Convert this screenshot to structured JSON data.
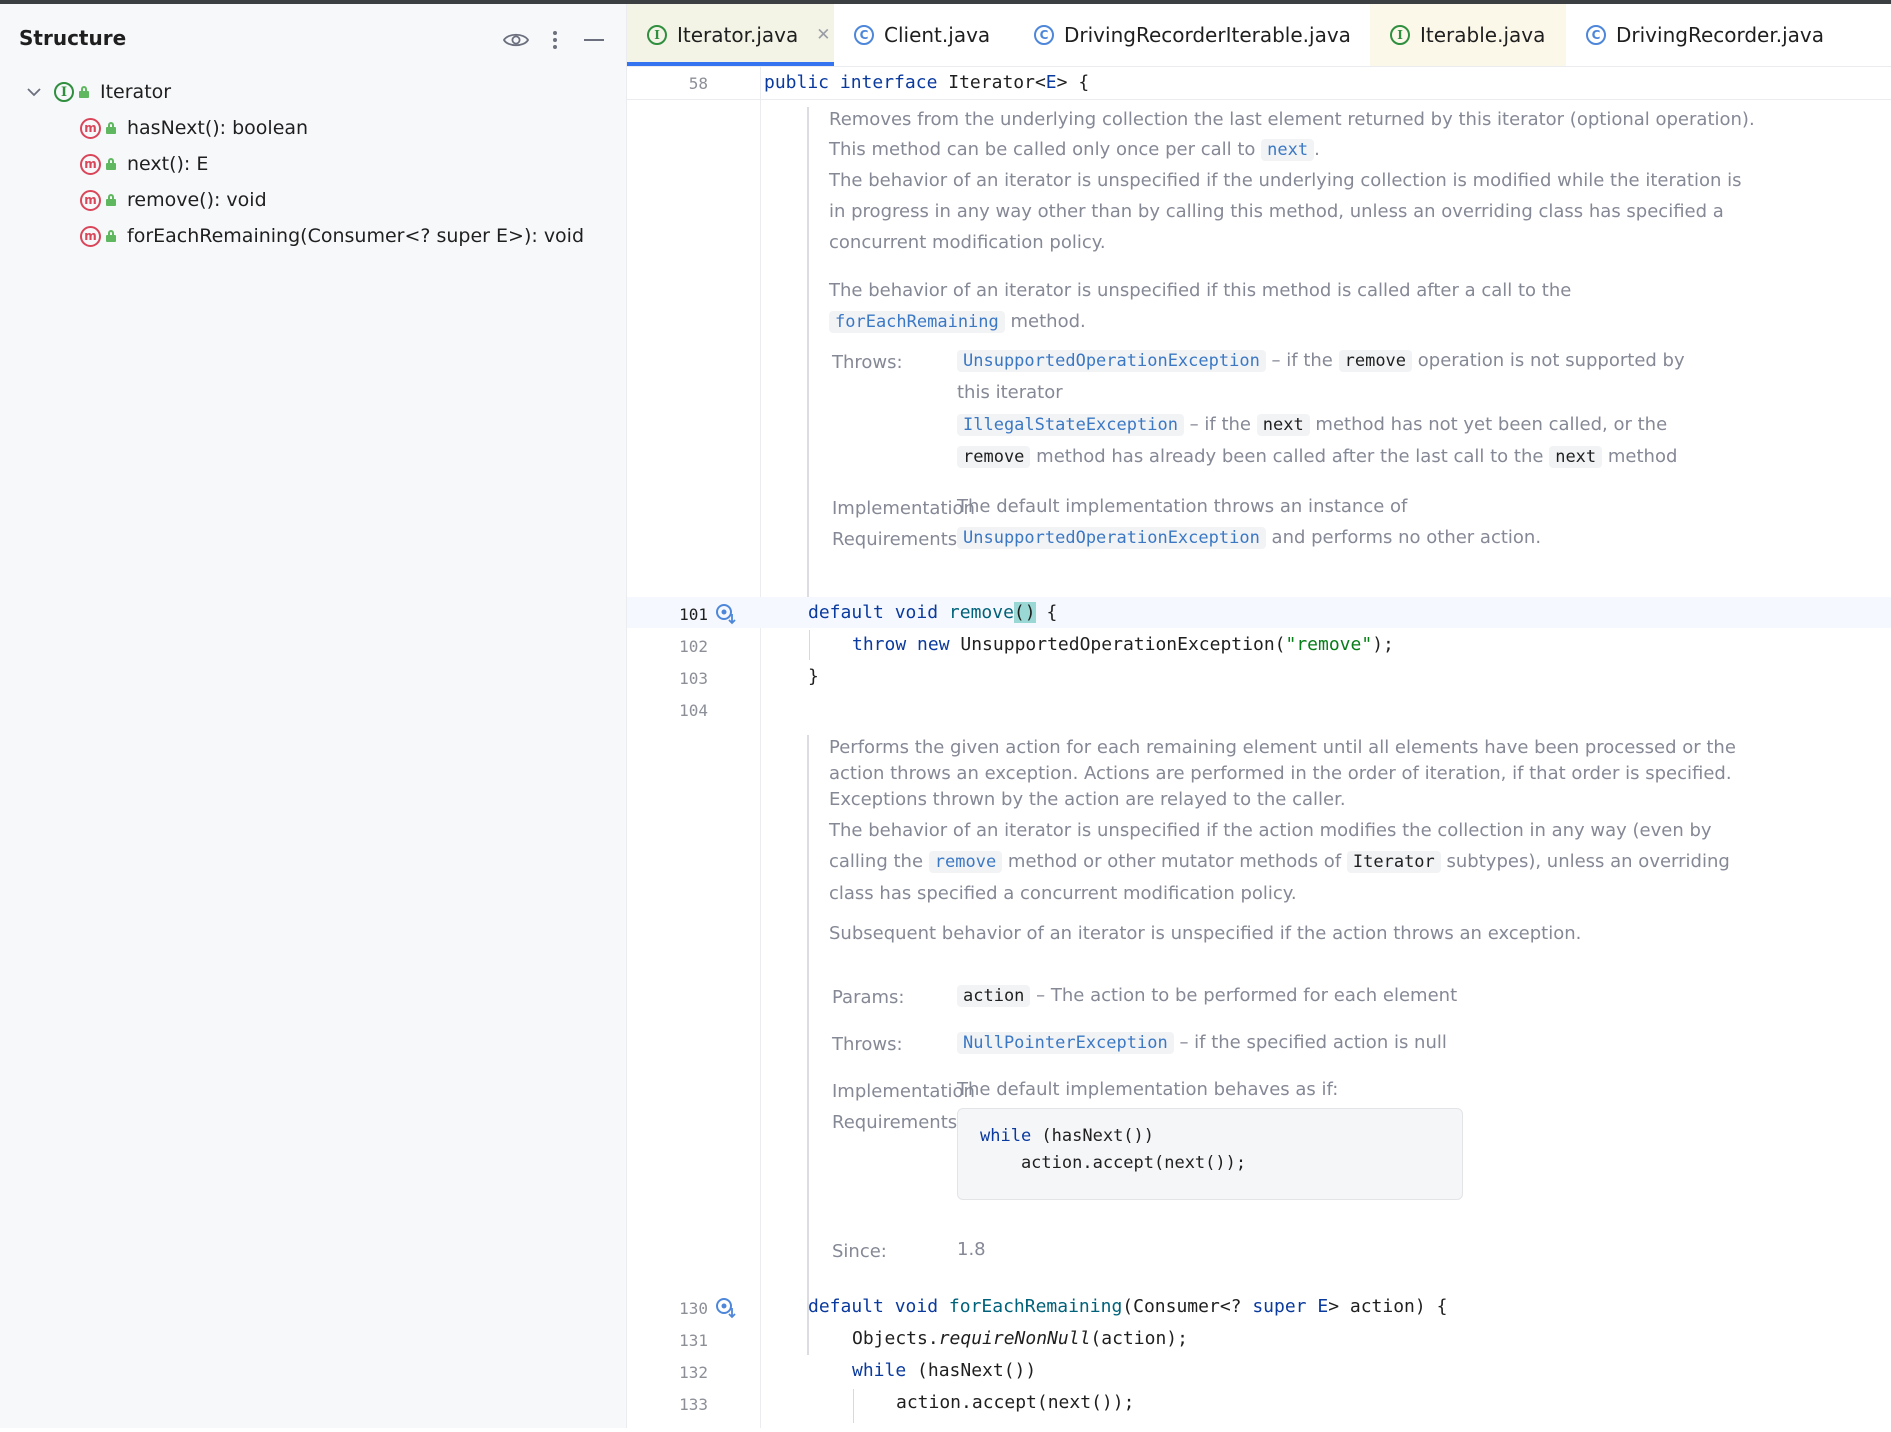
{
  "structure": {
    "title": "Structure",
    "root": "Iterator",
    "members": [
      "hasNext(): boolean",
      "next(): E",
      "remove(): void",
      "forEachRemaining(Consumer<? super E>): void"
    ]
  },
  "tabs": [
    {
      "label": "Iterator.java",
      "icon": "interface-icon",
      "active": true
    },
    {
      "label": "Client.java",
      "icon": "class-run-icon"
    },
    {
      "label": "DrivingRecorderIterable.java",
      "icon": "class-icon"
    },
    {
      "label": "Iterable.java",
      "icon": "interface-icon"
    },
    {
      "label": "DrivingRecorder.java",
      "icon": "class-icon"
    }
  ],
  "editor": {
    "header_line": {
      "number": "58",
      "code_kw1": "public",
      "code_kw2": "interface",
      "code_rest": " Iterator<",
      "code_type": "E",
      "code_end": "> {"
    },
    "remove_doc": {
      "p1a": "Removes from the underlying collection the last element returned by this iterator (optional operation).",
      "p1b": "This method can be called only once per call to",
      "p1b_ref": "next",
      "p1b_end": ".",
      "p2": "The behavior of an iterator is unspecified if the underlying collection is modified while the iteration is in progress in any way other than by calling this method, unless an overriding class has specified a concurrent modification policy.",
      "p3a": "The behavior of an iterator is unspecified if this method is called after a call to the",
      "p3_ref": "forEachRemaining",
      "p3b": "method.",
      "throws_label": "Throws:",
      "t1_ref": "UnsupportedOperationException",
      "t1_a": "– if the",
      "t1_code": "remove",
      "t1_b": "operation is not supported by this iterator",
      "t2_ref": "IllegalStateException",
      "t2_a": "– if the",
      "t2_code1": "next",
      "t2_b": "method has not yet been called, or the",
      "t2_code2": "remove",
      "t2_c": "method has already been called after the last call to the",
      "t2_code3": "next",
      "t2_d": "method",
      "impl_label1": "Implementation",
      "impl_label2": "Requirements:",
      "impl_a": "The default implementation throws an instance of",
      "impl_ref": "UnsupportedOperationException",
      "impl_b": "and performs no other action."
    },
    "remove_code": {
      "l101": "101",
      "l102": "102",
      "l103": "103",
      "l104": "104",
      "c101_kw": "default void",
      "c101_fn": "remove",
      "c101_paren": "()",
      "c101_end": " {",
      "c102_kw": "throw new",
      "c102_a": " UnsupportedOperationException(",
      "c102_str": "\"remove\"",
      "c102_end": ");",
      "c103": "}"
    },
    "fer_doc": {
      "p1": "Performs the given action for each remaining element until all elements have been processed or the action throws an exception. Actions are performed in the order of iteration, if that order is specified. Exceptions thrown by the action are relayed to the caller.",
      "p2a": "The behavior of an iterator is unspecified if the action modifies the collection in any way (even by calling the",
      "p2_ref": "remove",
      "p2b": "method or other mutator methods of",
      "p2_code": "Iterator",
      "p2c": "subtypes), unless an overriding class has specified a concurrent modification policy.",
      "p3": "Subsequent behavior of an iterator is unspecified if the action throws an exception.",
      "params_label": "Params:",
      "param_code": "action",
      "param_desc": "– The action to be performed for each element",
      "throws_label": "Throws:",
      "throw_ref": "NullPointerException",
      "throw_desc": "– if the specified action is null",
      "impl_label1": "Implementation",
      "impl_label2": "Requirements:",
      "impl_text": "The default implementation behaves as if:",
      "box_kw": "while",
      "box_l1": " (hasNext())",
      "box_l2": "    action.accept(next());",
      "since_label": "Since:",
      "since_val": "1.8"
    },
    "fer_code": {
      "l130": "130",
      "l131": "131",
      "l132": "132",
      "l133": "133",
      "c130_kw": "default void",
      "c130_fn": "forEachRemaining",
      "c130_a": "(Consumer<? ",
      "c130_kw2": "super",
      "c130_b": " ",
      "c130_type": "E",
      "c130_c": "> action) {",
      "c131_a": "Objects.",
      "c131_it": "requireNonNull",
      "c131_b": "(action);",
      "c132_kw": "while",
      "c132_a": " (hasNext())",
      "c133": "action.accept(next());"
    }
  }
}
